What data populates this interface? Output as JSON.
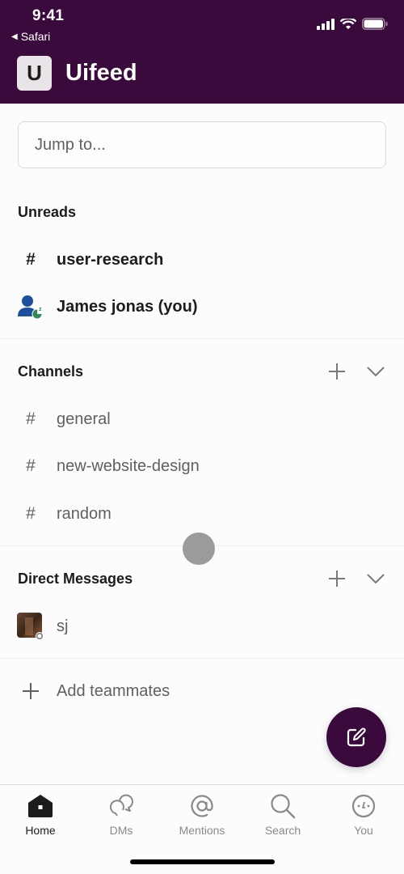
{
  "status_bar": {
    "time": "9:41",
    "back_app": "Safari"
  },
  "header": {
    "workspace_initial": "U",
    "workspace_name": "Uifeed"
  },
  "jump_to": {
    "placeholder": "Jump to..."
  },
  "unreads": {
    "title": "Unreads",
    "items": [
      {
        "type": "channel",
        "prefix": "#",
        "label": "user-research"
      },
      {
        "type": "dm-self",
        "label": "James jonas (you)"
      }
    ]
  },
  "channels": {
    "title": "Channels",
    "items": [
      {
        "prefix": "#",
        "label": "general"
      },
      {
        "prefix": "#",
        "label": "new-website-design"
      },
      {
        "prefix": "#",
        "label": "random"
      }
    ]
  },
  "direct_messages": {
    "title": "Direct Messages",
    "items": [
      {
        "label": "sj",
        "presence": "away"
      }
    ]
  },
  "add_teammates": {
    "label": "Add teammates"
  },
  "tabbar": {
    "tabs": [
      {
        "label": "Home",
        "active": true
      },
      {
        "label": "DMs"
      },
      {
        "label": "Mentions"
      },
      {
        "label": "Search"
      },
      {
        "label": "You"
      }
    ]
  },
  "colors": {
    "brand": "#3b0a3d",
    "text": "#1d1c1d",
    "muted": "#616061"
  }
}
